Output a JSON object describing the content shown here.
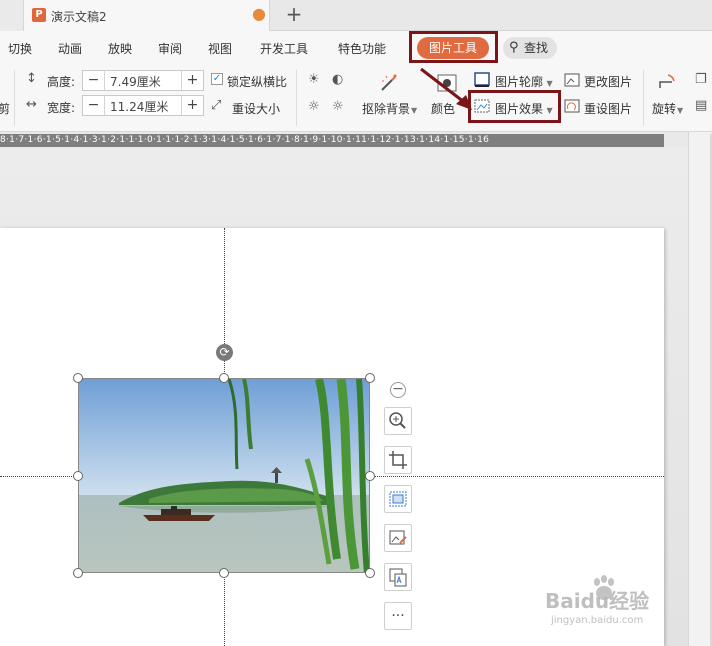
{
  "titlebar": {
    "doc_title": "演示文稿2",
    "doc_icon_letter": "P",
    "new_tab": "+",
    "modified_dot": "●"
  },
  "menu": {
    "items": [
      "切换",
      "动画",
      "放映",
      "审阅",
      "视图",
      "开发工具",
      "特色功能"
    ],
    "active_tab": "图片工具",
    "search_label": "查找"
  },
  "ribbon": {
    "height_label": "高度:",
    "height_value": "7.49厘米",
    "width_label": "宽度:",
    "width_value": "11.24厘米",
    "lock_ratio": "锁定纵横比",
    "reset_size": "重设大小",
    "remove_bg": "抠除背景",
    "color": "颜色",
    "outline": "图片轮廓",
    "effects": "图片效果",
    "change_pic": "更改图片",
    "reset_pic": "重设图片",
    "rotate": "旋转",
    "left_cut": "剪"
  },
  "ruler": {
    "text": "8·1·7·1·6·1·5·1·4·1·3·1·2·1·1·1·0·1·1·1·2·1·3·1·4·1·5·1·6·1·7·1·8·1·9·1·10·1·11·1·12·1·13·1·14·1·15·1·16"
  },
  "watermark": {
    "brand": "Baidu经验",
    "url": "jingyan.baidu.com"
  },
  "colors": {
    "accent": "#e06b40",
    "highlight_box": "#7a1519"
  }
}
